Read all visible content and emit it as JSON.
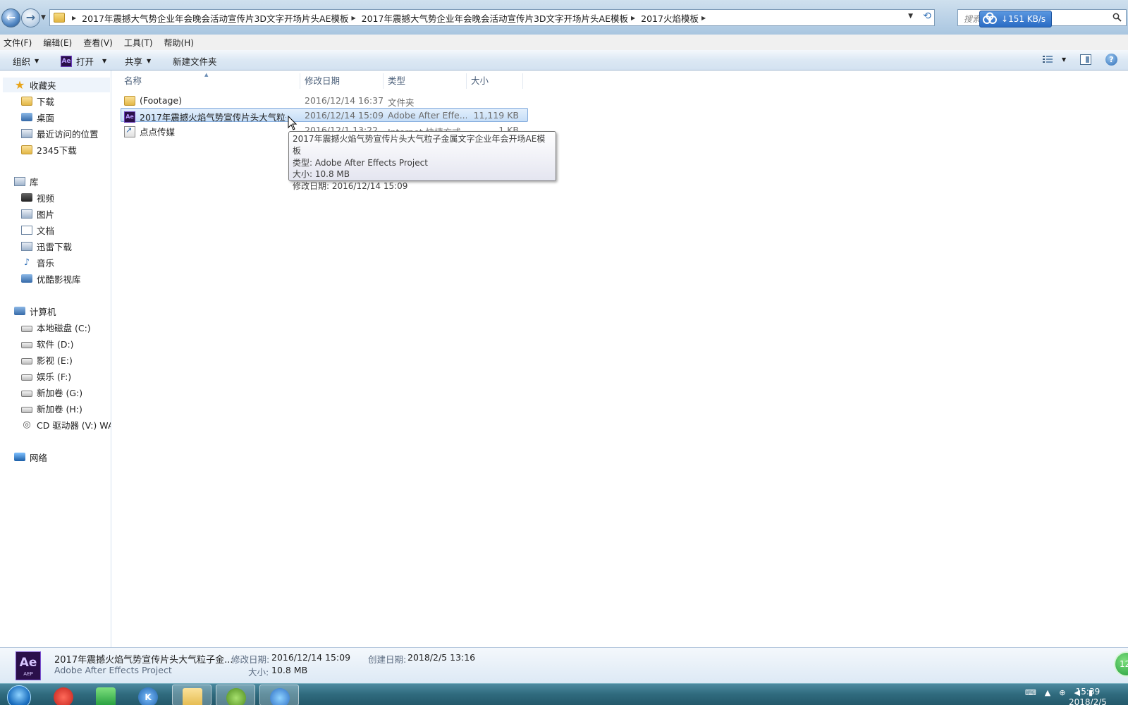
{
  "address": {
    "crumbs": [
      "2017年震撼大气势企业年会晚会活动宣传片3D文字开场片头AE模板",
      "2017年震撼大气势企业年会晚会活动宣传片3D文字开场片头AE模板",
      "2017火焰模板"
    ],
    "search_placeholder": "搜索",
    "speed": "151 KB/s"
  },
  "menu": [
    "文件(F)",
    "编辑(E)",
    "查看(V)",
    "工具(T)",
    "帮助(H)"
  ],
  "commands": {
    "organize": "组织",
    "open": "打开",
    "share": "共享",
    "new_folder": "新建文件夹"
  },
  "nav": {
    "favorites": {
      "label": "收藏夹",
      "items": [
        "下载",
        "桌面",
        "最近访问的位置",
        "2345下载"
      ]
    },
    "libraries": {
      "label": "库",
      "items": [
        "视频",
        "图片",
        "文档",
        "迅雷下载",
        "音乐",
        "优酷影视库"
      ]
    },
    "computer": {
      "label": "计算机",
      "items": [
        "本地磁盘 (C:)",
        "软件 (D:)",
        "影视 (E:)",
        "娱乐 (F:)",
        "新加卷 (G:)",
        "新加卷 (H:)",
        "CD 驱动器 (V:) WA'"
      ]
    },
    "network": {
      "label": "网络"
    }
  },
  "columns": {
    "name": "名称",
    "date": "修改日期",
    "type": "类型",
    "size": "大小"
  },
  "files": [
    {
      "name": "(Footage)",
      "date": "2016/12/14 16:37",
      "type": "文件夹",
      "size": ""
    },
    {
      "name": "2017年震撼火焰气势宣传片头大气粒子...",
      "date": "2016/12/14 15:09",
      "type": "Adobe After Effe...",
      "size": "11,119 KB"
    },
    {
      "name": "点点传媒",
      "date": "2016/12/1 13:22",
      "type": "Internet 快捷方式",
      "size": "1 KB"
    }
  ],
  "tooltip": {
    "line1": "2017年震撼火焰气势宣传片头大气粒子金属文字企业年会开场AE模板",
    "line2": "类型: Adobe After Effects Project",
    "line3": "大小: 10.8 MB",
    "line4": "修改日期: 2016/12/14 15:09"
  },
  "details": {
    "icon_big": "Ae",
    "icon_small": "AEP",
    "name": "2017年震撼火焰气势宣传片头大气粒子金...",
    "type": "Adobe After Effects Project",
    "modified_label": "修改日期:",
    "modified": "2016/12/14 15:09",
    "size_label": "大小:",
    "size": "10.8 MB",
    "created_label": "创建日期:",
    "created": "2018/2/5 13:16",
    "badge": "12"
  },
  "taskbar": {
    "time": "15:39",
    "date": "2018/2/5"
  }
}
